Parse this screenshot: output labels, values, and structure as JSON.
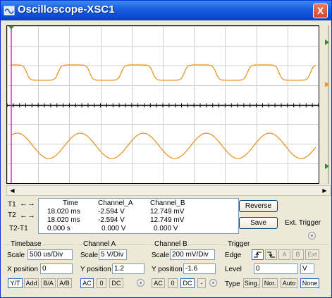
{
  "window": {
    "title": "Oscilloscope-XSC1",
    "close_glyph": "X"
  },
  "colors": {
    "trace_a": "#e8962a",
    "grid": "#cfcfcf",
    "cursor_t1": "#cc33cc",
    "cursor_t2": "#2e8b2e"
  },
  "measurements": {
    "row_labels": [
      "T1",
      "T2",
      "T2-T1"
    ],
    "headers": {
      "time": "Time",
      "channel_a": "Channel_A",
      "channel_b": "Channel_B"
    },
    "rows": [
      {
        "time": "18.020 ms",
        "channel_a": "-2.594 V",
        "channel_b": "12.749 mV"
      },
      {
        "time": "18.020 ms",
        "channel_a": "-2.594 V",
        "channel_b": "12.749 mV"
      },
      {
        "time": "0.000 s",
        "channel_a": "0.000 V",
        "channel_b": "0.000 V"
      }
    ],
    "reverse_label": "Reverse",
    "save_label": "Save",
    "ext_trigger_label": "Ext. Trigger"
  },
  "timebase": {
    "title": "Timebase",
    "scale_label": "Scale",
    "scale_value": "500 us/Div",
    "xpos_label": "X position",
    "xpos_value": "0",
    "buttons": [
      "Y/T",
      "Add",
      "B/A",
      "A/B"
    ]
  },
  "channel_a": {
    "title": "Channel A",
    "scale_label": "Scale",
    "scale_value": "5  V/Div",
    "ypos_label": "Y position",
    "ypos_value": "1.2",
    "coupling": [
      "AC",
      "0",
      "DC"
    ]
  },
  "channel_b": {
    "title": "Channel B",
    "scale_label": "Scale",
    "scale_value": "200 mV/Div",
    "ypos_label": "Y position",
    "ypos_value": "-1.6",
    "coupling": [
      "AC",
      "0",
      "DC",
      "-"
    ]
  },
  "trigger": {
    "title": "Trigger",
    "edge_label": "Edge",
    "edge_buttons": [
      "A",
      "B",
      "Ext"
    ],
    "level_label": "Level",
    "level_value": "0",
    "level_unit": "V",
    "type_label": "Type",
    "type_buttons": [
      "Sing.",
      "Nor.",
      "Auto",
      "None"
    ]
  }
}
